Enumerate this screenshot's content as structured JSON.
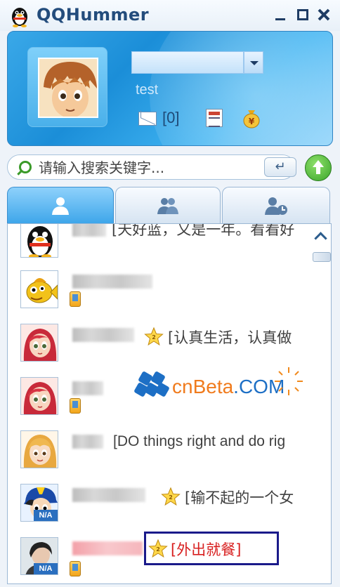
{
  "window": {
    "title": "QQHummer",
    "controls": [
      "minimize",
      "maximize",
      "close"
    ]
  },
  "profile": {
    "signature": "test",
    "mail_count": "[0]"
  },
  "search": {
    "placeholder": "请输入搜索关键字..."
  },
  "tabs": [
    {
      "icon": "contact-icon",
      "active": true
    },
    {
      "icon": "group-icon",
      "active": false
    },
    {
      "icon": "recent-contacts-icon",
      "active": false
    }
  ],
  "contacts": [
    {
      "status": "[天好蓝，又是一年。看看好",
      "avatar": "penguin"
    },
    {
      "status": "",
      "avatar": "fish",
      "mobile": true
    },
    {
      "status": "[认真生活，认真做",
      "avatar": "red-hair-girl",
      "vip": true
    },
    {
      "status": "",
      "avatar": "red-hair-girl",
      "mobile": true
    },
    {
      "status": "[DO things right and do rig",
      "avatar": "blonde-girl"
    },
    {
      "status": "[输不起的一个女",
      "avatar": "blue-cap-boy",
      "vip": true,
      "badge": "N/A"
    },
    {
      "status": "[外出就餐]",
      "avatar": "photo",
      "vip": true,
      "mobile": true,
      "badge": "N/A",
      "highlighted": true
    }
  ],
  "watermark": {
    "text_prefix": "cnBeta",
    "text_suffix": ".COM"
  },
  "colors": {
    "accent": "#2a9ae0",
    "highlight_text": "#d82020",
    "highlight_box": "#1a1a8a"
  }
}
